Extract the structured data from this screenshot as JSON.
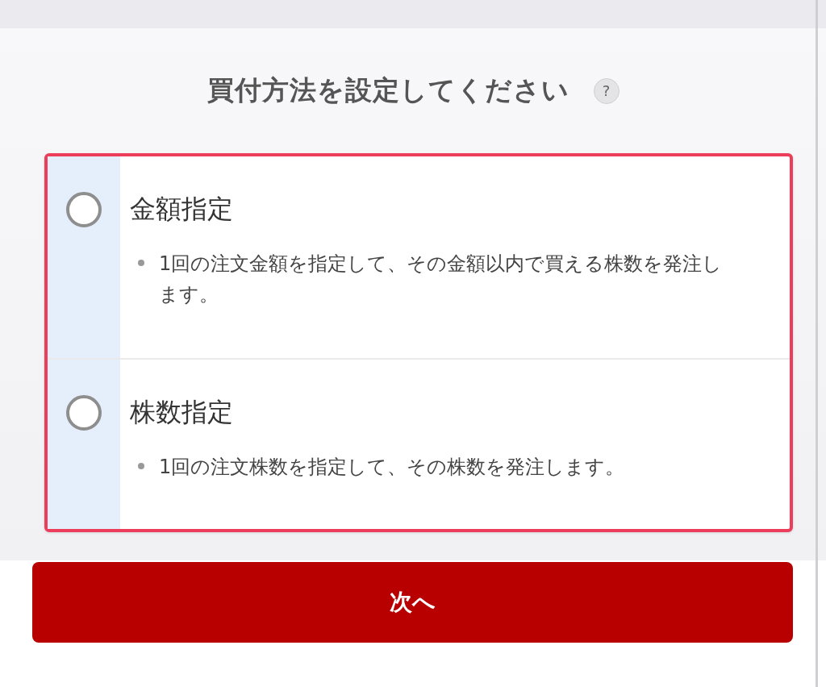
{
  "title": "買付方法を設定してください",
  "help_icon": "?",
  "options": [
    {
      "label": "金額指定",
      "description": "1回の注文金額を指定して、その金額以内で買える株数を発注します。",
      "selected": false
    },
    {
      "label": "株数指定",
      "description": "1回の注文株数を指定して、その株数を発注します。",
      "selected": false
    }
  ],
  "highlighted": true,
  "next_button": "次へ"
}
